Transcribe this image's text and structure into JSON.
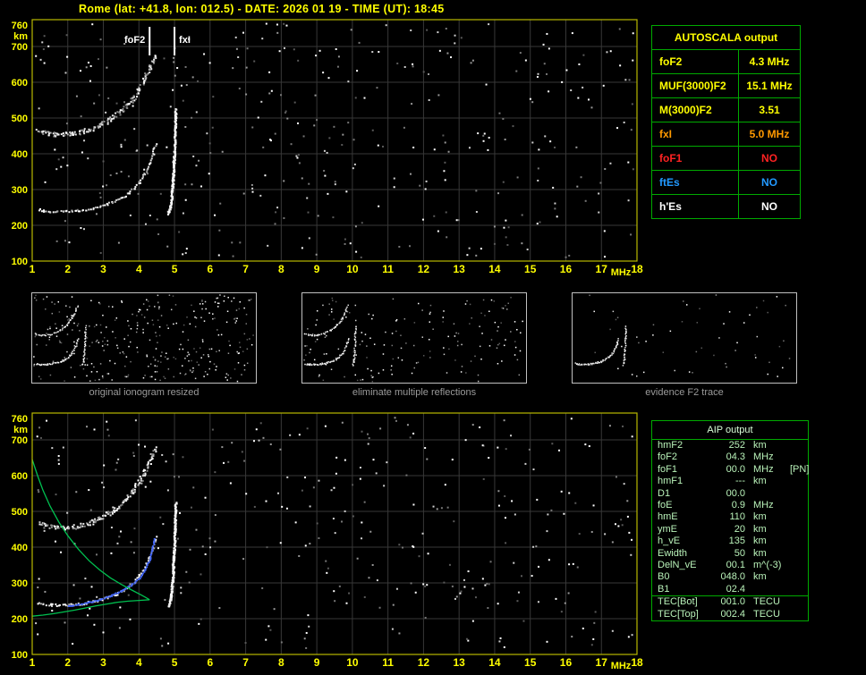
{
  "header": {
    "title": "Rome (lat: +41.8, lon: 012.5) - DATE: 2026 01 19 - TIME (UT): 18:45"
  },
  "autoscala": {
    "title": "AUTOSCALA output",
    "border_color": "#00aa00",
    "rows": [
      {
        "label": "foF2",
        "value": "4.3 MHz",
        "color": "#ffff00"
      },
      {
        "label": "MUF(3000)F2",
        "value": "15.1 MHz",
        "color": "#ffff00"
      },
      {
        "label": "M(3000)F2",
        "value": "3.51",
        "color": "#ffff00"
      },
      {
        "label": "fxI",
        "value": "5.0 MHz",
        "color": "#ff9900"
      },
      {
        "label": "foF1",
        "value": "NO",
        "color": "#ff2222"
      },
      {
        "label": "ftEs",
        "value": "NO",
        "color": "#2299ff"
      },
      {
        "label": "h'Es",
        "value": "NO",
        "color": "#ffffff"
      }
    ]
  },
  "aip": {
    "title": "AIP output",
    "border_color": "#00aa00",
    "text_color": "#b9f2b9",
    "rows": [
      {
        "name": "hmF2",
        "value": "252",
        "unit": "km",
        "note": ""
      },
      {
        "name": "foF2",
        "value": "04.3",
        "unit": "MHz",
        "note": ""
      },
      {
        "name": "foF1",
        "value": "00.0",
        "unit": "MHz",
        "note": "[PN]"
      },
      {
        "name": "hmF1",
        "value": "---",
        "unit": "km",
        "note": ""
      },
      {
        "name": "D1",
        "value": "00.0",
        "unit": "",
        "note": ""
      },
      {
        "name": "foE",
        "value": "0.9",
        "unit": "MHz",
        "note": ""
      },
      {
        "name": "hmE",
        "value": "110",
        "unit": "km",
        "note": ""
      },
      {
        "name": "ymE",
        "value": "20",
        "unit": "km",
        "note": ""
      },
      {
        "name": "h_vE",
        "value": "135",
        "unit": "km",
        "note": ""
      },
      {
        "name": "Ewidth",
        "value": "50",
        "unit": "km",
        "note": ""
      },
      {
        "name": "DelN_vE",
        "value": "00.1",
        "unit": "m^(-3)",
        "note": ""
      },
      {
        "name": "B0",
        "value": "048.0",
        "unit": "km",
        "note": ""
      },
      {
        "name": "B1",
        "value": "02.4",
        "unit": "",
        "note": ""
      },
      {
        "name": "TEC[Bot]",
        "value": "001.0",
        "unit": "TECU",
        "note": "",
        "sep": true
      },
      {
        "name": "TEC[Top]",
        "value": "002.4",
        "unit": "TECU",
        "note": ""
      }
    ]
  },
  "thumbnails": [
    {
      "caption": "original ionogram resized",
      "noise_count": 330,
      "series": [
        0,
        1,
        2
      ]
    },
    {
      "caption": "eliminate multiple reflections",
      "noise_count": 175,
      "series": [
        0,
        1,
        2
      ]
    },
    {
      "caption": "evidence F2 trace",
      "noise_count": 55,
      "series": [
        0,
        1
      ]
    }
  ],
  "chart_data": [
    {
      "id": "main-ionogram",
      "type": "scatter",
      "title": "",
      "xlabel": "MHz",
      "ylabel": "km",
      "xlim": [
        1,
        18
      ],
      "ylim": [
        100,
        760
      ],
      "xticks": [
        1,
        2,
        3,
        4,
        5,
        6,
        7,
        8,
        9,
        10,
        11,
        12,
        13,
        14,
        15,
        16,
        17,
        18
      ],
      "yticks": [
        100,
        200,
        300,
        400,
        500,
        600,
        700,
        760
      ],
      "grid": true,
      "noise_seed": 20260119,
      "noise_count": 380,
      "markers": [
        {
          "label": "foF2",
          "x": 4.3,
          "side": "left"
        },
        {
          "label": "fxI",
          "x": 5.0,
          "side": "right"
        }
      ],
      "series": [
        {
          "name": "F2-trace-O-mode",
          "style": "speckle",
          "color": "#ffffff",
          "points": [
            [
              1.15,
              246
            ],
            [
              1.3,
              243
            ],
            [
              1.5,
              241
            ],
            [
              1.7,
              240
            ],
            [
              1.9,
              240
            ],
            [
              2.1,
              241
            ],
            [
              2.3,
              243
            ],
            [
              2.5,
              246
            ],
            [
              2.7,
              250
            ],
            [
              2.9,
              255
            ],
            [
              3.1,
              261
            ],
            [
              3.3,
              269
            ],
            [
              3.5,
              279
            ],
            [
              3.7,
              292
            ],
            [
              3.85,
              305
            ],
            [
              4.0,
              322
            ],
            [
              4.15,
              345
            ],
            [
              4.28,
              372
            ],
            [
              4.38,
              402
            ],
            [
              4.45,
              432
            ]
          ]
        },
        {
          "name": "F2-trace-X-mode",
          "style": "speckle-dense",
          "color": "#ffffff",
          "points": [
            [
              4.82,
              235
            ],
            [
              4.87,
              255
            ],
            [
              4.9,
              280
            ],
            [
              4.93,
              310
            ],
            [
              4.95,
              345
            ],
            [
              4.97,
              385
            ],
            [
              4.99,
              430
            ],
            [
              5.0,
              475
            ],
            [
              5.02,
              525
            ]
          ]
        },
        {
          "name": "second-hop-trace",
          "style": "speckle-fuzzy",
          "color": "#cccccc",
          "points": [
            [
              1.15,
              468
            ],
            [
              1.4,
              460
            ],
            [
              1.65,
              456
            ],
            [
              1.9,
              456
            ],
            [
              2.15,
              459
            ],
            [
              2.4,
              464
            ],
            [
              2.65,
              472
            ],
            [
              2.9,
              483
            ],
            [
              3.15,
              497
            ],
            [
              3.4,
              515
            ],
            [
              3.6,
              533
            ],
            [
              3.8,
              556
            ],
            [
              4.0,
              584
            ],
            [
              4.15,
              612
            ],
            [
              4.3,
              645
            ],
            [
              4.42,
              678
            ]
          ]
        }
      ]
    },
    {
      "id": "profile-ionogram",
      "type": "scatter",
      "title": "",
      "xlabel": "MHz",
      "ylabel": "km",
      "xlim": [
        1,
        18
      ],
      "ylim": [
        100,
        760
      ],
      "xticks": [
        1,
        2,
        3,
        4,
        5,
        6,
        7,
        8,
        9,
        10,
        11,
        12,
        13,
        14,
        15,
        16,
        17,
        18
      ],
      "yticks": [
        100,
        200,
        300,
        400,
        500,
        600,
        700,
        760
      ],
      "grid": true,
      "noise_seed": 1845,
      "noise_count": 340,
      "markers": [],
      "series": [
        {
          "name": "F2-trace-O-mode",
          "style": "speckle",
          "color": "#ffffff",
          "points": [
            [
              1.15,
              246
            ],
            [
              1.3,
              243
            ],
            [
              1.5,
              241
            ],
            [
              1.7,
              240
            ],
            [
              1.9,
              240
            ],
            [
              2.1,
              241
            ],
            [
              2.3,
              243
            ],
            [
              2.5,
              246
            ],
            [
              2.7,
              250
            ],
            [
              2.9,
              255
            ],
            [
              3.1,
              261
            ],
            [
              3.3,
              269
            ],
            [
              3.5,
              279
            ],
            [
              3.7,
              292
            ],
            [
              3.85,
              305
            ],
            [
              4.0,
              322
            ],
            [
              4.15,
              345
            ],
            [
              4.28,
              372
            ],
            [
              4.38,
              402
            ],
            [
              4.45,
              432
            ]
          ]
        },
        {
          "name": "F2-trace-X-mode",
          "style": "speckle-dense",
          "color": "#ffffff",
          "points": [
            [
              4.82,
              235
            ],
            [
              4.87,
              255
            ],
            [
              4.9,
              280
            ],
            [
              4.93,
              310
            ],
            [
              4.95,
              345
            ],
            [
              4.97,
              385
            ],
            [
              4.99,
              430
            ],
            [
              5.0,
              475
            ],
            [
              5.02,
              525
            ]
          ]
        },
        {
          "name": "second-hop-trace",
          "style": "speckle-fuzzy",
          "color": "#cccccc",
          "points": [
            [
              1.15,
              468
            ],
            [
              1.4,
              460
            ],
            [
              1.65,
              456
            ],
            [
              1.9,
              456
            ],
            [
              2.15,
              459
            ],
            [
              2.4,
              464
            ],
            [
              2.65,
              472
            ],
            [
              2.9,
              483
            ],
            [
              3.15,
              497
            ],
            [
              3.4,
              515
            ],
            [
              3.6,
              533
            ],
            [
              3.8,
              556
            ],
            [
              4.0,
              584
            ],
            [
              4.15,
              612
            ],
            [
              4.3,
              645
            ],
            [
              4.42,
              678
            ]
          ]
        },
        {
          "name": "autoscala-fitted-trace",
          "style": "dots",
          "color": "#4468ff",
          "points": [
            [
              2.0,
              238
            ],
            [
              2.3,
              242
            ],
            [
              2.6,
              248
            ],
            [
              2.9,
              256
            ],
            [
              3.2,
              266
            ],
            [
              3.5,
              280
            ],
            [
              3.8,
              298
            ],
            [
              4.0,
              316
            ],
            [
              4.15,
              338
            ],
            [
              4.28,
              365
            ],
            [
              4.36,
              395
            ],
            [
              4.42,
              425
            ]
          ]
        },
        {
          "name": "profile-topside",
          "style": "line",
          "color": "#00c050",
          "points": [
            [
              1.0,
              645
            ],
            [
              1.15,
              600
            ],
            [
              1.3,
              560
            ],
            [
              1.5,
              515
            ],
            [
              1.75,
              470
            ],
            [
              2.0,
              432
            ],
            [
              2.3,
              394
            ],
            [
              2.6,
              362
            ],
            [
              2.9,
              336
            ],
            [
              3.2,
              314
            ],
            [
              3.5,
              296
            ],
            [
              3.8,
              280
            ],
            [
              4.05,
              267
            ],
            [
              4.2,
              259
            ],
            [
              4.3,
              253
            ]
          ]
        },
        {
          "name": "profile-bottomside",
          "style": "line",
          "color": "#00c050",
          "points": [
            [
              1.0,
              207
            ],
            [
              1.3,
              210
            ],
            [
              1.6,
              214
            ],
            [
              1.9,
              219
            ],
            [
              2.2,
              224
            ],
            [
              2.5,
              230
            ],
            [
              2.8,
              236
            ],
            [
              3.1,
              241
            ],
            [
              3.4,
              246
            ],
            [
              3.7,
              249
            ],
            [
              4.0,
              251
            ],
            [
              4.3,
              253
            ]
          ]
        }
      ]
    }
  ]
}
